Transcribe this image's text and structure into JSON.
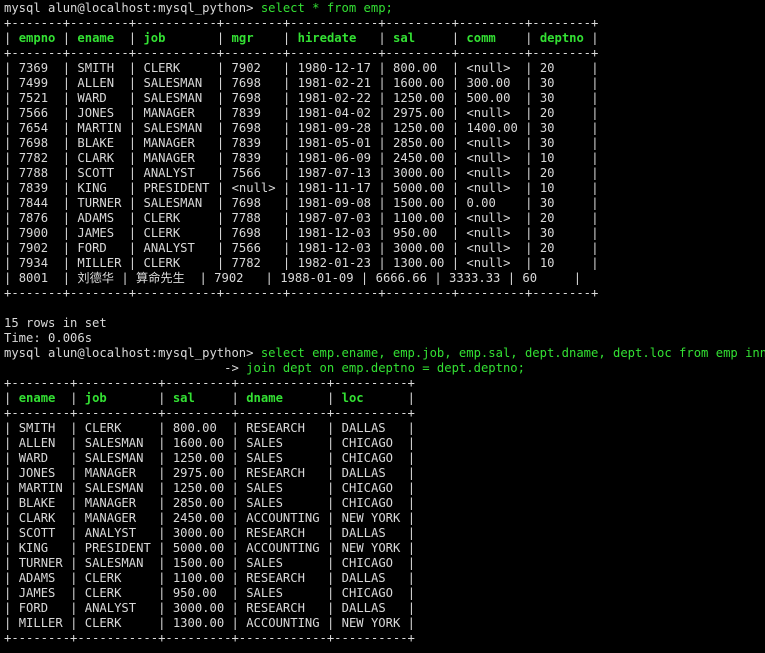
{
  "session": {
    "prompt": "mysql alun@localhost:mysql_python> ",
    "continuation": "                              -> "
  },
  "query1": {
    "command": "select * from emp;",
    "columns": [
      "empno",
      "ename",
      "job",
      "mgr",
      "hiredate",
      "sal",
      "comm",
      "deptno"
    ],
    "rows": [
      [
        "7369",
        "SMITH",
        "CLERK",
        "7902",
        "1980-12-17",
        "800.00",
        "<null>",
        "20"
      ],
      [
        "7499",
        "ALLEN",
        "SALESMAN",
        "7698",
        "1981-02-21",
        "1600.00",
        "300.00",
        "30"
      ],
      [
        "7521",
        "WARD",
        "SALESMAN",
        "7698",
        "1981-02-22",
        "1250.00",
        "500.00",
        "30"
      ],
      [
        "7566",
        "JONES",
        "MANAGER",
        "7839",
        "1981-04-02",
        "2975.00",
        "<null>",
        "20"
      ],
      [
        "7654",
        "MARTIN",
        "SALESMAN",
        "7698",
        "1981-09-28",
        "1250.00",
        "1400.00",
        "30"
      ],
      [
        "7698",
        "BLAKE",
        "MANAGER",
        "7839",
        "1981-05-01",
        "2850.00",
        "<null>",
        "30"
      ],
      [
        "7782",
        "CLARK",
        "MANAGER",
        "7839",
        "1981-06-09",
        "2450.00",
        "<null>",
        "10"
      ],
      [
        "7788",
        "SCOTT",
        "ANALYST",
        "7566",
        "1987-07-13",
        "3000.00",
        "<null>",
        "20"
      ],
      [
        "7839",
        "KING",
        "PRESIDENT",
        "<null>",
        "1981-11-17",
        "5000.00",
        "<null>",
        "10"
      ],
      [
        "7844",
        "TURNER",
        "SALESMAN",
        "7698",
        "1981-09-08",
        "1500.00",
        "0.00",
        "30"
      ],
      [
        "7876",
        "ADAMS",
        "CLERK",
        "7788",
        "1987-07-03",
        "1100.00",
        "<null>",
        "20"
      ],
      [
        "7900",
        "JAMES",
        "CLERK",
        "7698",
        "1981-12-03",
        "950.00",
        "<null>",
        "30"
      ],
      [
        "7902",
        "FORD",
        "ANALYST",
        "7566",
        "1981-12-03",
        "3000.00",
        "<null>",
        "20"
      ],
      [
        "7934",
        "MILLER",
        "CLERK",
        "7782",
        "1982-01-23",
        "1300.00",
        "<null>",
        "10"
      ],
      [
        "8001",
        "刘德华",
        "算命先生",
        "7902",
        "1988-01-09",
        "6666.66",
        "3333.33",
        "60"
      ]
    ],
    "rows_text": "15 rows in set",
    "time_text": "Time: 0.006s"
  },
  "query2": {
    "command_line1": "select emp.ename, emp.job, emp.sal, dept.dname, dept.loc from emp inner",
    "command_line2": "join dept on emp.deptno = dept.deptno;",
    "columns": [
      "ename",
      "job",
      "sal",
      "dname",
      "loc"
    ],
    "rows": [
      [
        "SMITH",
        "CLERK",
        "800.00",
        "RESEARCH",
        "DALLAS"
      ],
      [
        "ALLEN",
        "SALESMAN",
        "1600.00",
        "SALES",
        "CHICAGO"
      ],
      [
        "WARD",
        "SALESMAN",
        "1250.00",
        "SALES",
        "CHICAGO"
      ],
      [
        "JONES",
        "MANAGER",
        "2975.00",
        "RESEARCH",
        "DALLAS"
      ],
      [
        "MARTIN",
        "SALESMAN",
        "1250.00",
        "SALES",
        "CHICAGO"
      ],
      [
        "BLAKE",
        "MANAGER",
        "2850.00",
        "SALES",
        "CHICAGO"
      ],
      [
        "CLARK",
        "MANAGER",
        "2450.00",
        "ACCOUNTING",
        "NEW YORK"
      ],
      [
        "SCOTT",
        "ANALYST",
        "3000.00",
        "RESEARCH",
        "DALLAS"
      ],
      [
        "KING",
        "PRESIDENT",
        "5000.00",
        "ACCOUNTING",
        "NEW YORK"
      ],
      [
        "TURNER",
        "SALESMAN",
        "1500.00",
        "SALES",
        "CHICAGO"
      ],
      [
        "ADAMS",
        "CLERK",
        "1100.00",
        "RESEARCH",
        "DALLAS"
      ],
      [
        "JAMES",
        "CLERK",
        "950.00",
        "SALES",
        "CHICAGO"
      ],
      [
        "FORD",
        "ANALYST",
        "3000.00",
        "RESEARCH",
        "DALLAS"
      ],
      [
        "MILLER",
        "CLERK",
        "1300.00",
        "ACCOUNTING",
        "NEW YORK"
      ]
    ]
  },
  "colors": {
    "background": "#000000",
    "text": "#d9d9d9",
    "keyword": "#33e033"
  }
}
